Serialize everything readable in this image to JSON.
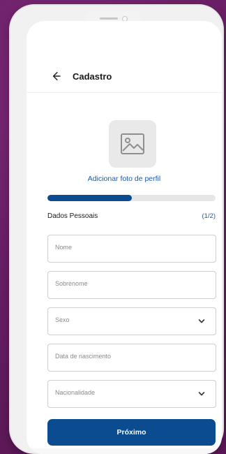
{
  "header": {
    "title": "Cadastro"
  },
  "profile": {
    "add_photo_label": "Adicionar foto de perfil"
  },
  "progress": {
    "fraction": 0.5
  },
  "section": {
    "title": "Dados Pessoais",
    "step": "(1/2)"
  },
  "fields": {
    "nome": "Nome",
    "sobrenome": "Sobrenome",
    "sexo": "Sexo",
    "data_nascimento": "Data de nascimento",
    "nacionalidade": "Nacionalidade"
  },
  "actions": {
    "next_label": "Próximo"
  },
  "colors": {
    "accent": "#0b4b8f",
    "link": "#1b5aa6",
    "background": "#6b1f66"
  },
  "icons": {
    "back": "arrow-left-icon",
    "image": "image-placeholder-icon",
    "chevron": "chevron-down-icon"
  }
}
